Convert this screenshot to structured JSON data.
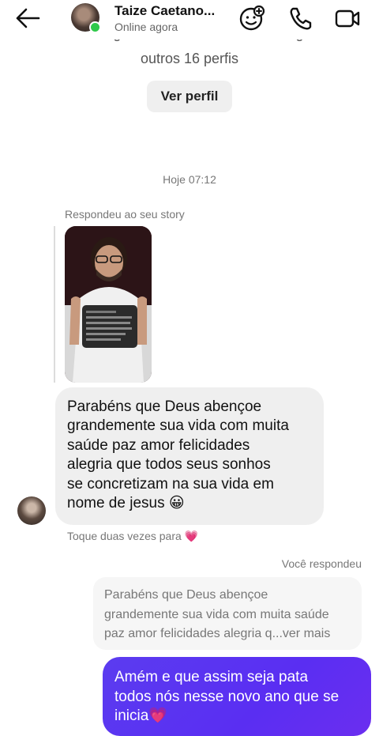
{
  "header": {
    "contact_name": "Taize Caetano...",
    "status": "Online agora"
  },
  "profile_card": {
    "partial_line": "Vocês seguem caetanocristianocamargo e",
    "others_line": "outros 16 perfis",
    "view_profile_label": "Ver perfil"
  },
  "chat": {
    "timestamp": "Hoje 07:12",
    "story_reply_label": "Respondeu ao seu story",
    "incoming_message": "Parabéns que Deus abençoe\ngrandemente sua vida com muita\nsaúde paz amor felicidades\nalegria que todos seus sonhos\nse concretizam na sua vida em\nnome de jesus 😀",
    "double_tap_hint": "Toque duas vezes para",
    "double_tap_heart": "💗",
    "you_replied_label": "Você respondeu",
    "quoted_message": "Parabéns que Deus abençoe\ngrandemente sua vida com muita saúde\npaz amor felicidades alegria q...ver mais",
    "outgoing_message": "Amém e que assim seja pata\ntodos nós nesse novo ano que se\ninicia💗"
  },
  "icons": {
    "back": "arrow-left-icon",
    "effects": "sticker-face-plus-icon",
    "call": "phone-icon",
    "video": "video-camera-icon"
  },
  "colors": {
    "outgoing_bubble": "#5a2ef2",
    "incoming_bubble": "#efefef",
    "online": "#2fc94a"
  }
}
